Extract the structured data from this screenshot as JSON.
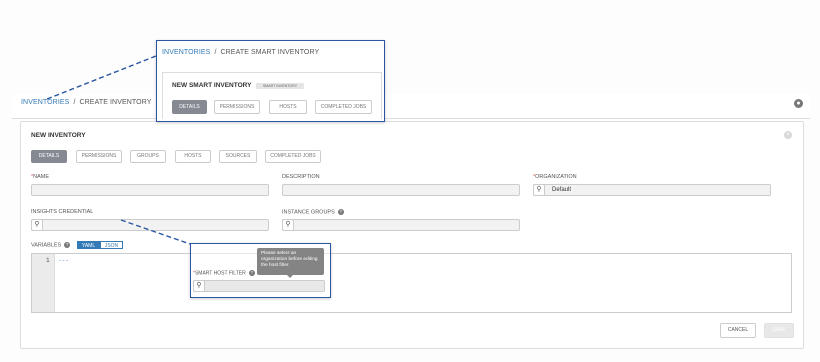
{
  "breadcrumb": {
    "root": "INVENTORIES",
    "separator": "/",
    "current": "CREATE INVENTORY"
  },
  "panel": {
    "title": "NEW INVENTORY",
    "tabs": [
      {
        "label": "DETAILS",
        "active": true
      },
      {
        "label": "PERMISSIONS",
        "active": false
      },
      {
        "label": "GROUPS",
        "active": false
      },
      {
        "label": "HOSTS",
        "active": false
      },
      {
        "label": "SOURCES",
        "active": false
      },
      {
        "label": "COMPLETED JOBS",
        "active": false
      }
    ]
  },
  "form": {
    "name_label": "NAME",
    "description_label": "DESCRIPTION",
    "organization_label": "ORGANIZATION",
    "organization_value": "Default",
    "insights_label": "INSIGHTS CREDENTIAL",
    "instance_groups_label": "INSTANCE GROUPS",
    "variables_label": "VARIABLES",
    "yaml": "YAML",
    "json": "JSON",
    "line_number": "1",
    "code": "---",
    "required_mark": "*"
  },
  "actions": {
    "cancel": "CANCEL",
    "save": "SAVE"
  },
  "zoom_top": {
    "breadcrumb_root": "INVENTORIES",
    "breadcrumb_current": "CREATE SMART INVENTORY",
    "title": "NEW SMART INVENTORY",
    "badge": "SMART INVENTORY",
    "tabs": [
      "DETAILS",
      "PERMISSIONS",
      "HOSTS",
      "COMPLETED JOBS"
    ]
  },
  "zoom_bottom": {
    "tooltip": "Please select an organization before editing the host filter.",
    "filter_label": "SMART HOST FILTER"
  },
  "colors": {
    "accent": "#337ab7",
    "zoom_border": "#2a56a1",
    "required": "#d9534f",
    "active_tab": "#848992"
  },
  "icons": [
    "globe-icon",
    "close-icon",
    "search-icon",
    "help-icon"
  ]
}
